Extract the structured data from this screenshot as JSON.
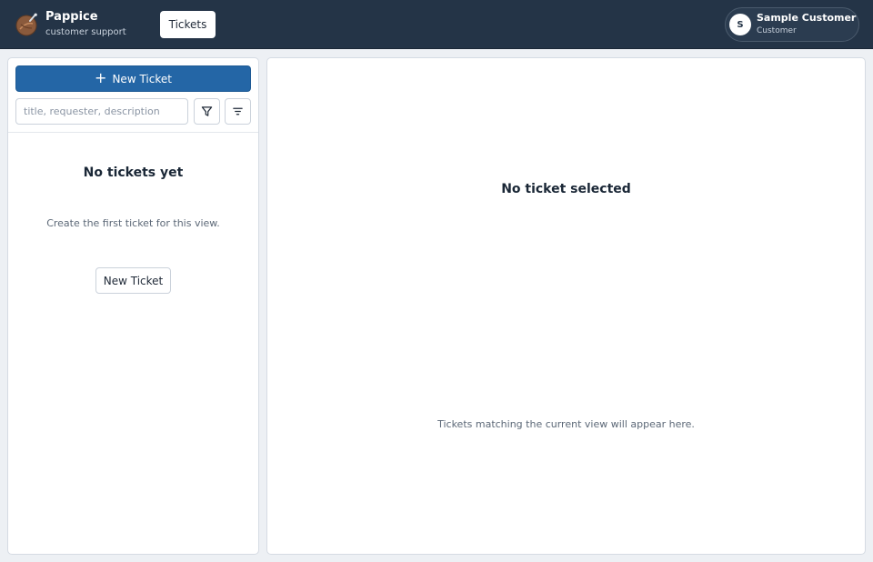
{
  "header": {
    "app_name": "Pappice",
    "app_subtitle": "customer support",
    "nav_tab": "Tickets",
    "user": {
      "initial": "S",
      "name": "Sample Customer",
      "role": "Customer"
    }
  },
  "sidebar": {
    "new_ticket_label": "New Ticket",
    "search_placeholder": "title, requester, description",
    "search_value": "",
    "filter_icon": "filter-icon",
    "sort_icon": "sort-lines-icon",
    "empty_title": "No tickets yet",
    "empty_subtitle": "Create the first ticket for this view.",
    "empty_action_label": "New Ticket"
  },
  "detail": {
    "title": "No ticket selected",
    "subtitle": "Tickets matching the current view will appear here."
  },
  "colors": {
    "topbar": "#243447",
    "primary": "#2466a6",
    "background": "#edf0f4"
  }
}
